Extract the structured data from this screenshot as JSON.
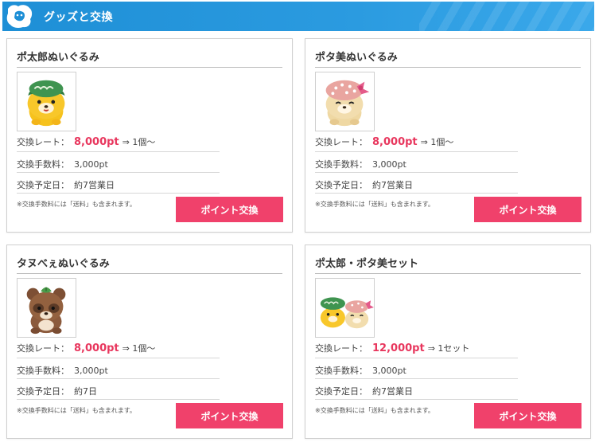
{
  "header": {
    "title": "グッズと交換",
    "icon": "mascot-logo-icon"
  },
  "labels": {
    "rate": "交換レート：",
    "fee": "交換手数料：",
    "schedule": "交換予定日：",
    "arrow": "⇒"
  },
  "colors": {
    "accent": "#f0416b",
    "header": "#1e8fd6",
    "price": "#e8365d"
  },
  "cards": [
    {
      "title": "ポ太郎ぬいぐるみ",
      "image": "potaro-plush-image",
      "points": "8,000pt",
      "quantity": "1個～",
      "fee": "3,000pt",
      "schedule": "約7営業日",
      "note": "※交換手数料には「送料」も含まれます。",
      "button": "ポイント交換"
    },
    {
      "title": "ポタ美ぬいぐるみ",
      "image": "potami-plush-image",
      "points": "8,000pt",
      "quantity": "1個～",
      "fee": "3,000pt",
      "schedule": "約7営業日",
      "note": "※交換手数料には「送料」も含まれます。",
      "button": "ポイント交換"
    },
    {
      "title": "タヌべぇぬいぐるみ",
      "image": "tanubee-plush-image",
      "points": "8,000pt",
      "quantity": "1個～",
      "fee": "3,000pt",
      "schedule": "約7日",
      "note": "※交換手数料には「送料」も含まれます。",
      "button": "ポイント交換"
    },
    {
      "title": "ポ太郎・ポタ美セット",
      "image": "potaro-potami-set-image",
      "points": "12,000pt",
      "quantity": "1セット",
      "fee": "3,000pt",
      "schedule": "約7営業日",
      "note": "※交換手数料には「送料」も含まれます。",
      "button": "ポイント交換"
    }
  ]
}
